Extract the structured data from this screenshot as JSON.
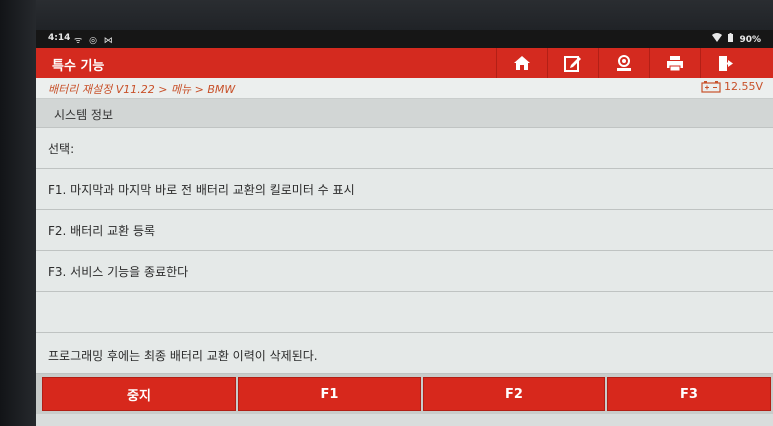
{
  "status_bar": {
    "time": "4:14",
    "icons": "ᯤ ◎ ⋈",
    "battery": "90%"
  },
  "header": {
    "title": "특수 기능"
  },
  "breadcrumb": {
    "path": "배터리 재설정 V11.22 > 메뉴 > BMW",
    "voltage": "12.55V"
  },
  "section": {
    "title": "시스템 정보"
  },
  "rows": [
    {
      "label": "선택:"
    },
    {
      "label": "F1. 마지막과 마지막 바로 전 배터리 교환의 킬로미터 수 표시"
    },
    {
      "label": "F2. 배터리 교환 등록"
    },
    {
      "label": "F3. 서비스 기능을 종료한다"
    },
    {
      "label": ""
    },
    {
      "label": "프로그래밍 후에는 최종 배터리 교환 이력이 삭제된다."
    }
  ],
  "buttons": {
    "stop": "중지",
    "f1": "F1",
    "f2": "F2",
    "f3": "F3"
  },
  "colors": {
    "accent": "#d42a1f",
    "breadcrumb": "#c8512a"
  }
}
